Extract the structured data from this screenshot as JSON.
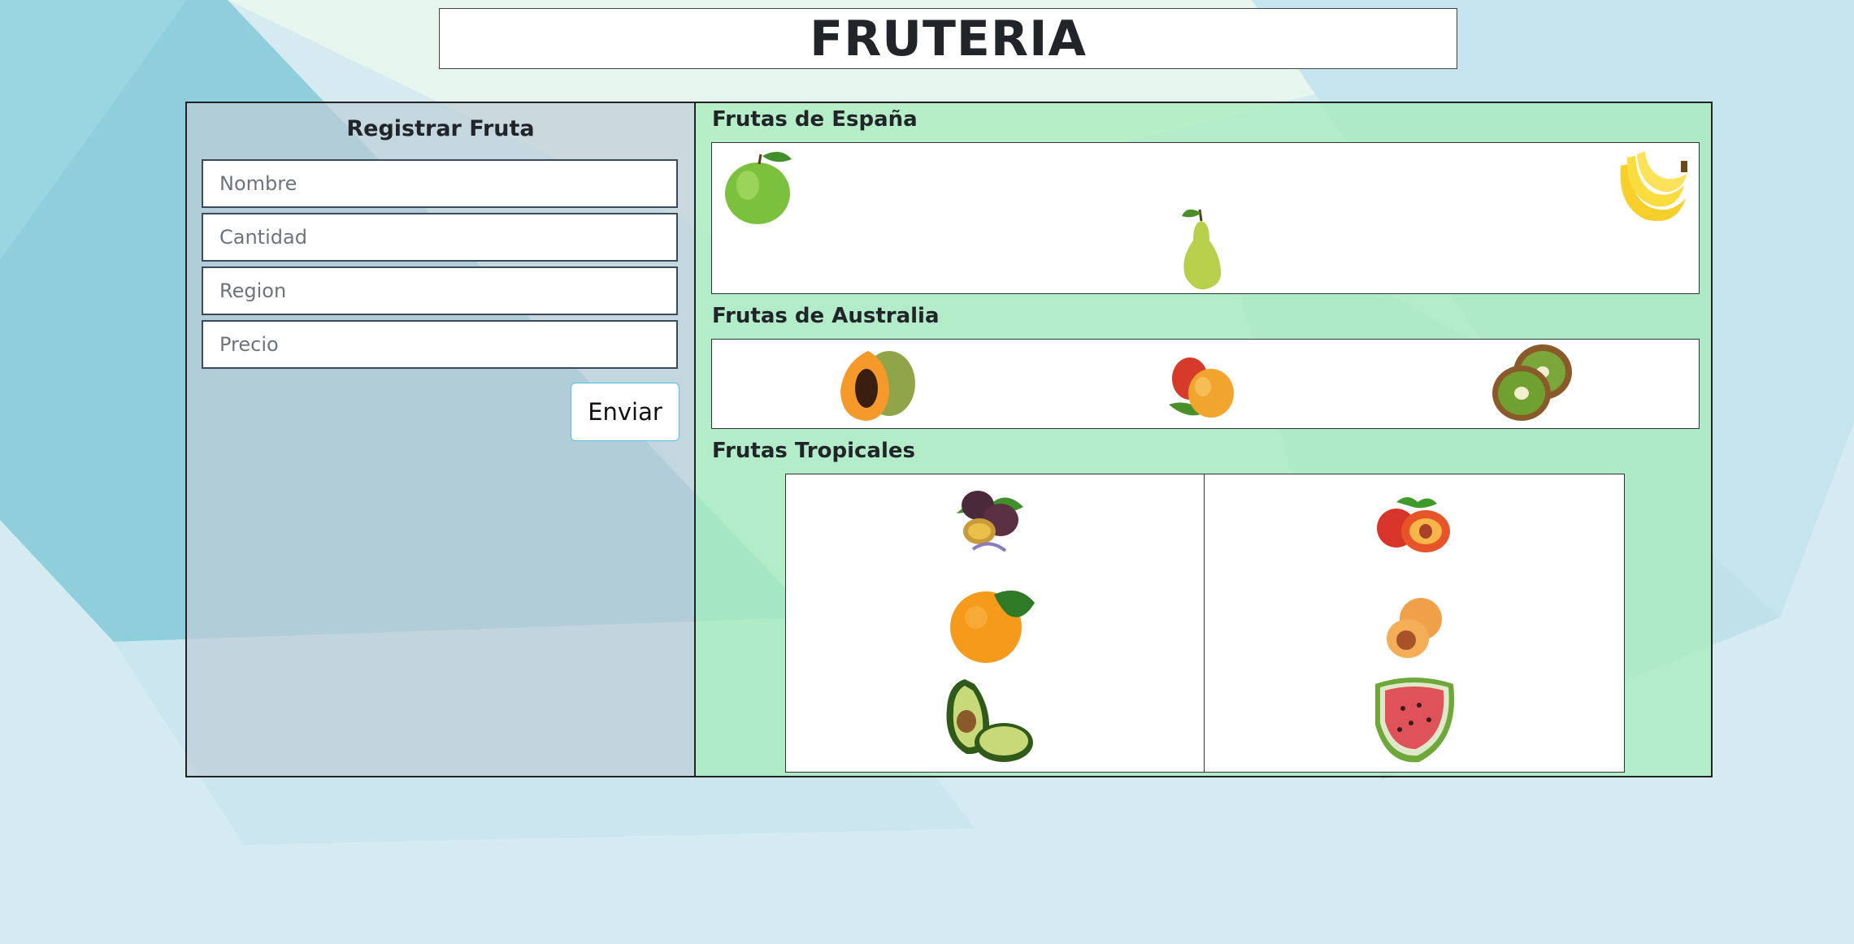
{
  "header": {
    "title": "FRUTERIA"
  },
  "form": {
    "title": "Registrar Fruta",
    "fields": [
      {
        "placeholder": "Nombre",
        "value": ""
      },
      {
        "placeholder": "Cantidad",
        "value": ""
      },
      {
        "placeholder": "Region",
        "value": ""
      },
      {
        "placeholder": "Precio",
        "value": ""
      }
    ],
    "submit_label": "Enviar"
  },
  "sections": {
    "spain": {
      "title": "Frutas de España",
      "fruits": [
        "apple-icon",
        "pear-icon",
        "banana-icon"
      ]
    },
    "australia": {
      "title": "Frutas de Australia",
      "fruits": [
        "papaya-icon",
        "mango-icon",
        "kiwi-icon"
      ]
    },
    "tropical": {
      "title": "Frutas Tropicales",
      "left_fruits": [
        "passion-fruit-icon",
        "orange-icon",
        "avocado-icon"
      ],
      "right_fruits": [
        "nectarine-icon",
        "apricot-icon",
        "watermelon-icon"
      ]
    }
  },
  "colors": {
    "form_panel": "#c1d4dd",
    "fruit_panel": "#b0ebc4",
    "accent_button_border": "#4fc3dd"
  }
}
